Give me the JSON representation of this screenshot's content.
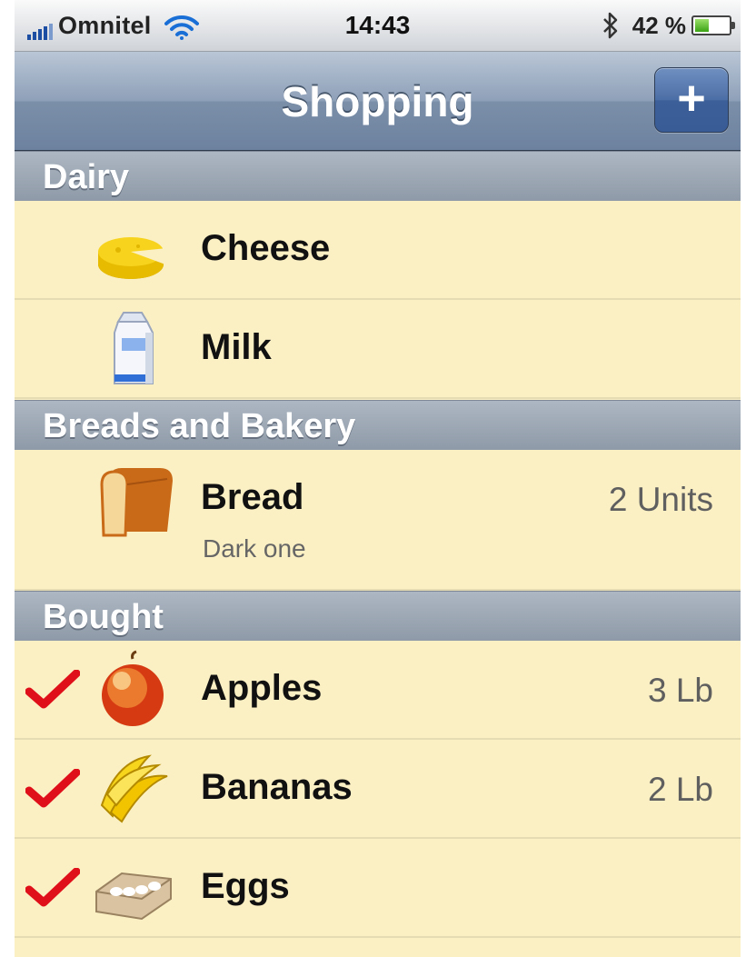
{
  "status_bar": {
    "carrier": "Omnitel",
    "time": "14:43",
    "battery_percent": "42 %",
    "battery_level": 0.42,
    "icons": [
      "signal-icon",
      "wifi-icon",
      "bluetooth-icon",
      "battery-icon"
    ]
  },
  "nav": {
    "title": "Shopping",
    "add_label": "+"
  },
  "sections": [
    {
      "title": "Dairy",
      "items": [
        {
          "name": "Cheese",
          "icon": "cheese-icon",
          "quantity": "",
          "note": "",
          "checked": false
        },
        {
          "name": "Milk",
          "icon": "milk-icon",
          "quantity": "",
          "note": "",
          "checked": false
        }
      ]
    },
    {
      "title": "Breads and Bakery",
      "items": [
        {
          "name": "Bread",
          "icon": "bread-icon",
          "quantity": "2 Units",
          "note": "Dark one",
          "checked": false
        }
      ]
    },
    {
      "title": "Bought",
      "items": [
        {
          "name": "Apples",
          "icon": "apple-icon",
          "quantity": "3 Lb",
          "note": "",
          "checked": true
        },
        {
          "name": "Bananas",
          "icon": "banana-icon",
          "quantity": "2 Lb",
          "note": "",
          "checked": true
        },
        {
          "name": "Eggs",
          "icon": "eggs-icon",
          "quantity": "",
          "note": "",
          "checked": true
        }
      ]
    }
  ],
  "colors": {
    "row_background": "#fbf0c4",
    "nav_bar": "#7b8fa9",
    "section_header": "#9ea8b5",
    "check_mark": "#e0101a"
  }
}
